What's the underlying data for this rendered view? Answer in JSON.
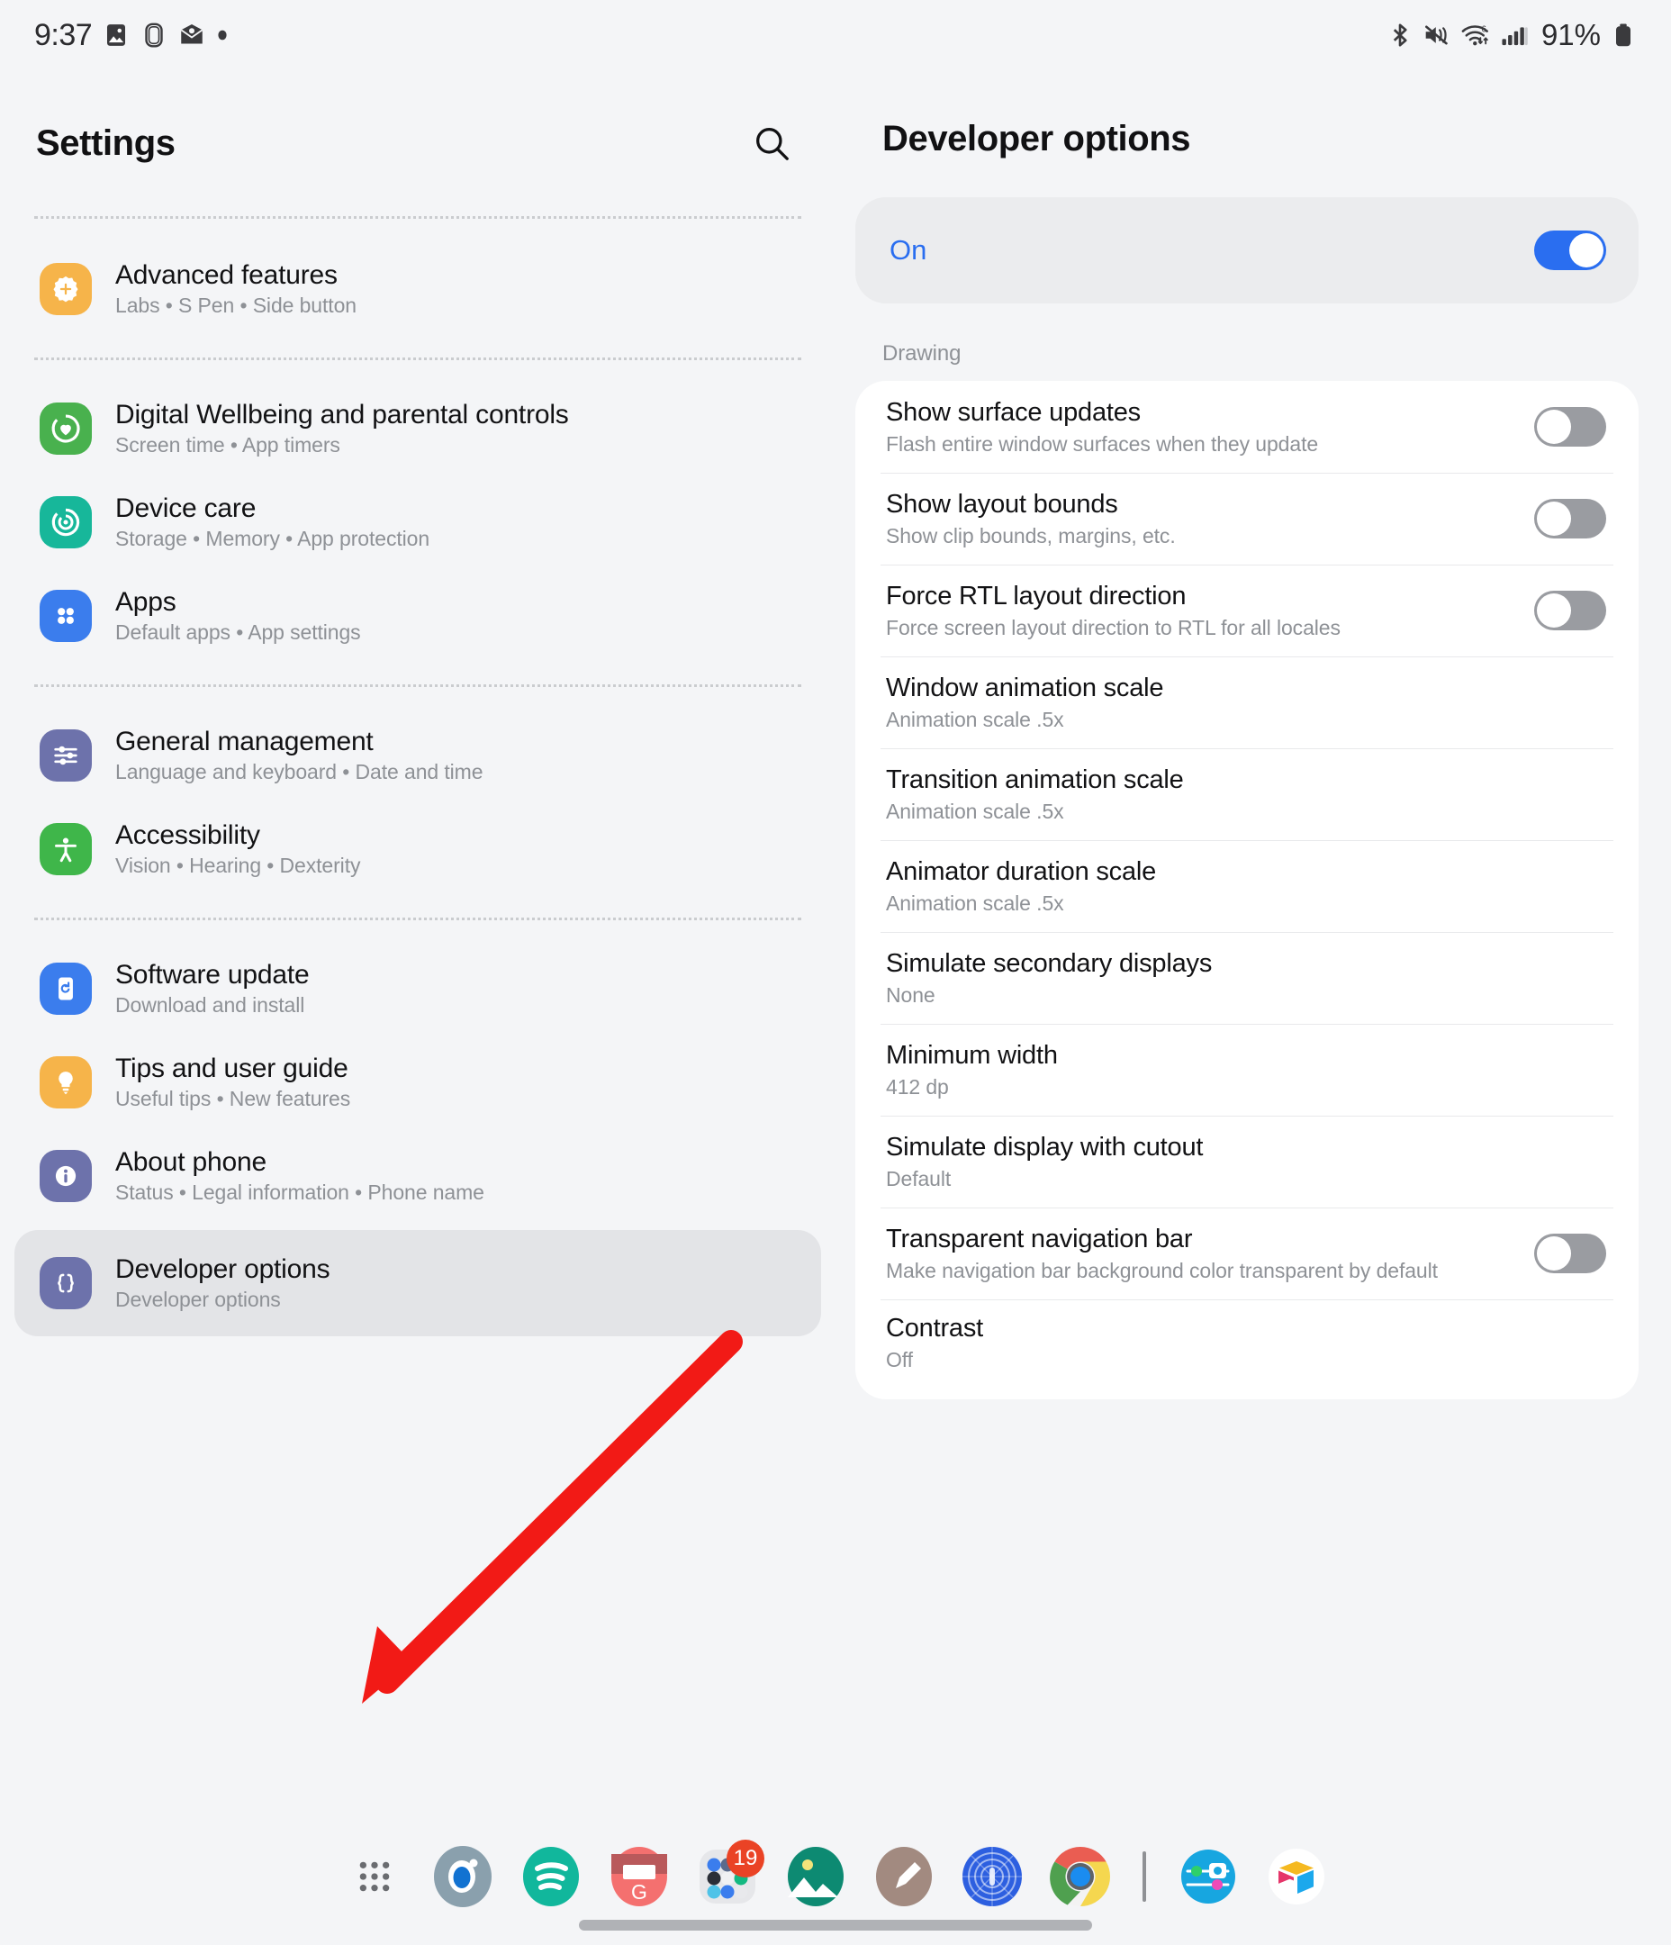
{
  "status_bar": {
    "time": "9:37",
    "left_icons": [
      "image-icon",
      "screen-recorder-icon",
      "mail-icon",
      "dot-icon"
    ],
    "right_icons": [
      "bluetooth-icon",
      "mute-vibrate-icon",
      "wifi6-icon",
      "cellular-signal-icon"
    ],
    "battery_percent": "91%",
    "battery_icon": "battery-full-icon"
  },
  "left_pane": {
    "title": "Settings",
    "search_icon": "search-icon",
    "groups": [
      {
        "items": [
          {
            "title": "Advanced features",
            "subtitle": "Labs  •  S Pen  •  Side button",
            "icon": "advanced-features-icon",
            "icon_color": "#f6b44a",
            "selected": false
          }
        ]
      },
      {
        "items": [
          {
            "title": "Digital Wellbeing and parental controls",
            "subtitle": "Screen time  •  App timers",
            "icon": "digital-wellbeing-icon",
            "icon_color": "#49b14e",
            "selected": false
          },
          {
            "title": "Device care",
            "subtitle": "Storage  •  Memory  •  App protection",
            "icon": "device-care-icon",
            "icon_color": "#17b79a",
            "selected": false
          },
          {
            "title": "Apps",
            "subtitle": "Default apps  •  App settings",
            "icon": "apps-icon",
            "icon_color": "#3b7ded",
            "selected": false
          }
        ]
      },
      {
        "items": [
          {
            "title": "General management",
            "subtitle": "Language and keyboard  •  Date and time",
            "icon": "sliders-icon",
            "icon_color": "#6d72ab",
            "selected": false
          },
          {
            "title": "Accessibility",
            "subtitle": "Vision  •  Hearing  •  Dexterity",
            "icon": "accessibility-icon",
            "icon_color": "#3fb64a",
            "selected": false
          }
        ]
      },
      {
        "items": [
          {
            "title": "Software update",
            "subtitle": "Download and install",
            "icon": "software-update-icon",
            "icon_color": "#3b7ded",
            "selected": false
          },
          {
            "title": "Tips and user guide",
            "subtitle": "Useful tips  •  New features",
            "icon": "lightbulb-icon",
            "icon_color": "#f6b44a",
            "selected": false
          },
          {
            "title": "About phone",
            "subtitle": "Status  •  Legal information  •  Phone name",
            "icon": "info-icon",
            "icon_color": "#6d72ab",
            "selected": false
          },
          {
            "title": "Developer options",
            "subtitle": "Developer options",
            "icon": "braces-icon",
            "icon_color": "#6d72ab",
            "selected": true
          }
        ]
      }
    ]
  },
  "right_pane": {
    "title": "Developer options",
    "master_toggle": {
      "label": "On",
      "state": "on",
      "accent": "#2a6ef0"
    },
    "section_label": "Drawing",
    "options": [
      {
        "title": "Show surface updates",
        "subtitle": "Flash entire window surfaces when they update",
        "control": "toggle",
        "state": "off"
      },
      {
        "title": "Show layout bounds",
        "subtitle": "Show clip bounds, margins, etc.",
        "control": "toggle",
        "state": "off"
      },
      {
        "title": "Force RTL layout direction",
        "subtitle": "Force screen layout direction to RTL for all locales",
        "control": "toggle",
        "state": "off"
      },
      {
        "title": "Window animation scale",
        "subtitle": "Animation scale .5x",
        "control": "none",
        "state": ""
      },
      {
        "title": "Transition animation scale",
        "subtitle": "Animation scale .5x",
        "control": "none",
        "state": ""
      },
      {
        "title": "Animator duration scale",
        "subtitle": "Animation scale .5x",
        "control": "none",
        "state": ""
      },
      {
        "title": "Simulate secondary displays",
        "subtitle": "None",
        "control": "none",
        "state": ""
      },
      {
        "title": "Minimum width",
        "subtitle": "412 dp",
        "control": "none",
        "state": ""
      },
      {
        "title": "Simulate display with cutout",
        "subtitle": "Default",
        "control": "none",
        "state": ""
      },
      {
        "title": "Transparent navigation bar",
        "subtitle": "Make navigation bar background color transparent by default",
        "control": "toggle",
        "state": "off"
      },
      {
        "title": "Contrast",
        "subtitle": "Off",
        "control": "none",
        "state": ""
      }
    ]
  },
  "dock": {
    "items": [
      {
        "name": "app-drawer-icon",
        "badge": ""
      },
      {
        "name": "samsung-internet-icon",
        "badge": ""
      },
      {
        "name": "spotify-icon",
        "badge": ""
      },
      {
        "name": "gmail-icon",
        "badge": ""
      },
      {
        "name": "app-folder-icon",
        "badge": "19"
      },
      {
        "name": "gallery-icon",
        "badge": ""
      },
      {
        "name": "samsung-notes-icon",
        "badge": ""
      },
      {
        "name": "onepassword-icon",
        "badge": ""
      },
      {
        "name": "chrome-icon",
        "badge": ""
      },
      {
        "name": "divider",
        "badge": ""
      },
      {
        "name": "device-settings-icon",
        "badge": ""
      },
      {
        "name": "airtable-icon",
        "badge": ""
      }
    ]
  },
  "annotation": {
    "type": "red-arrow",
    "color": "#f21a16",
    "points_to": "Developer options"
  }
}
